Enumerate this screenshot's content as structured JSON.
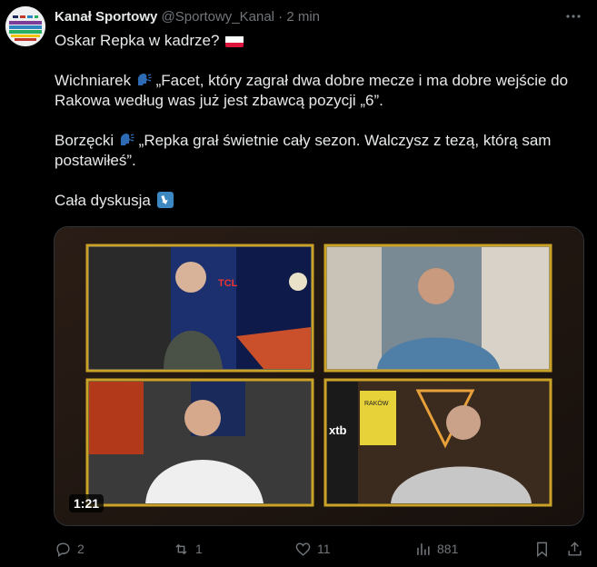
{
  "author": {
    "name": "Kanał Sportowy",
    "handle": "@Sportowy_Kanal",
    "separator": "·",
    "time": "2 min"
  },
  "tweet": {
    "line1": "Oskar Repka w kadrze?",
    "p2_speaker": "Wichniarek",
    "p2_text": "„Facet, który zagrał dwa dobre mecze i ma dobre wejście do Rakowa według was już jest zbawcą pozycji „6”.",
    "p3_speaker": "Borzęcki",
    "p3_text": "„Repka grał świetnie cały sezon. Walczysz z tezą, którą sam postawiłeś”.",
    "p4": "Cała dyskusja"
  },
  "media": {
    "duration": "1:21",
    "overlay_texts": {
      "tcl": "TCL",
      "xtb": "xtb",
      "rakow": "RAKÓW"
    }
  },
  "actions": {
    "replies": "2",
    "reposts": "1",
    "likes": "11",
    "views": "881"
  }
}
